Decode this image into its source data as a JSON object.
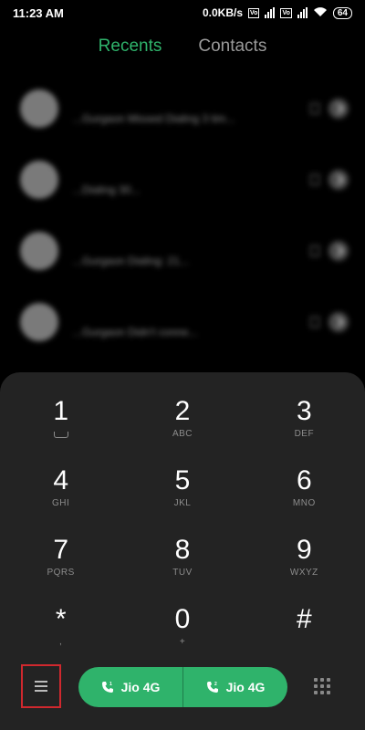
{
  "status": {
    "time": "11:23 AM",
    "speed": "0.0KB/s",
    "volte": "Vo",
    "battery": "64"
  },
  "tabs": [
    {
      "label": "Recents",
      "active": true
    },
    {
      "label": "Contacts",
      "active": false
    }
  ],
  "recents": [
    {
      "name": "",
      "sub": "...Gurgaon Missed Dialing 3 tim...",
      "missed": true
    },
    {
      "name": "",
      "sub": "...Dialing 30...",
      "missed": false
    },
    {
      "name": "",
      "sub": "...Gurgaon Dialing: 21...",
      "missed": false
    },
    {
      "name": "",
      "sub": "...Gurgaon Didn't conne...",
      "missed": false
    }
  ],
  "keypad": [
    {
      "digit": "1",
      "letters": ""
    },
    {
      "digit": "2",
      "letters": "ABC"
    },
    {
      "digit": "3",
      "letters": "DEF"
    },
    {
      "digit": "4",
      "letters": "GHI"
    },
    {
      "digit": "5",
      "letters": "JKL"
    },
    {
      "digit": "6",
      "letters": "MNO"
    },
    {
      "digit": "7",
      "letters": "PQRS"
    },
    {
      "digit": "8",
      "letters": "TUV"
    },
    {
      "digit": "9",
      "letters": "WXYZ"
    },
    {
      "digit": "*",
      "letters": ","
    },
    {
      "digit": "0",
      "letters": "+"
    },
    {
      "digit": "#",
      "letters": ""
    }
  ],
  "calls": [
    {
      "label": "Jio 4G",
      "sim": "1"
    },
    {
      "label": "Jio 4G",
      "sim": "2"
    }
  ],
  "colors": {
    "accent": "#2fb36b",
    "missed": "#e0342e",
    "highlight": "#d0282e"
  }
}
